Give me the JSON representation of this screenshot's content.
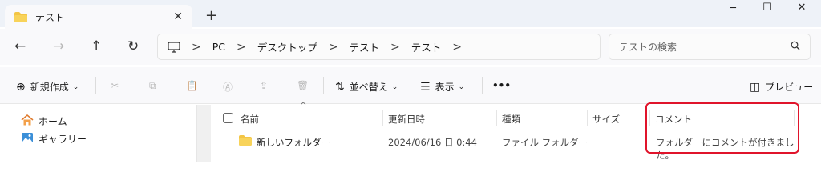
{
  "window": {
    "tab_title": "テスト",
    "tab_close": "✕",
    "new_tab": "+",
    "minimize": "─",
    "maximize": "☐",
    "close": "✕"
  },
  "nav": {
    "back": "←",
    "forward": "→",
    "up": "↑",
    "refresh": "↻"
  },
  "address": {
    "crumbs": [
      "PC",
      "デスクトップ",
      "テスト",
      "テスト"
    ],
    "separator": ">"
  },
  "search": {
    "placeholder": "テストの検索"
  },
  "toolbar": {
    "new_label": "新規作成",
    "sort_label": "並べ替え",
    "view_label": "表示",
    "more": "•••",
    "preview_label": "プレビュー"
  },
  "sidebar": {
    "items": [
      {
        "label": "ホーム",
        "icon": "home-icon"
      },
      {
        "label": "ギャラリー",
        "icon": "gallery-icon"
      }
    ]
  },
  "filelist": {
    "columns": [
      "名前",
      "更新日時",
      "種類",
      "サイズ",
      "コメント"
    ],
    "rows": [
      {
        "name": "新しいフォルダー",
        "modified": "2024/06/16 日 0:44",
        "type": "ファイル フォルダー",
        "size": "",
        "comment": "フォルダーにコメントが付きました。"
      }
    ]
  },
  "colors": {
    "highlight": "#e0142b",
    "folder": "#f3c545",
    "accent": "#005fb8"
  }
}
